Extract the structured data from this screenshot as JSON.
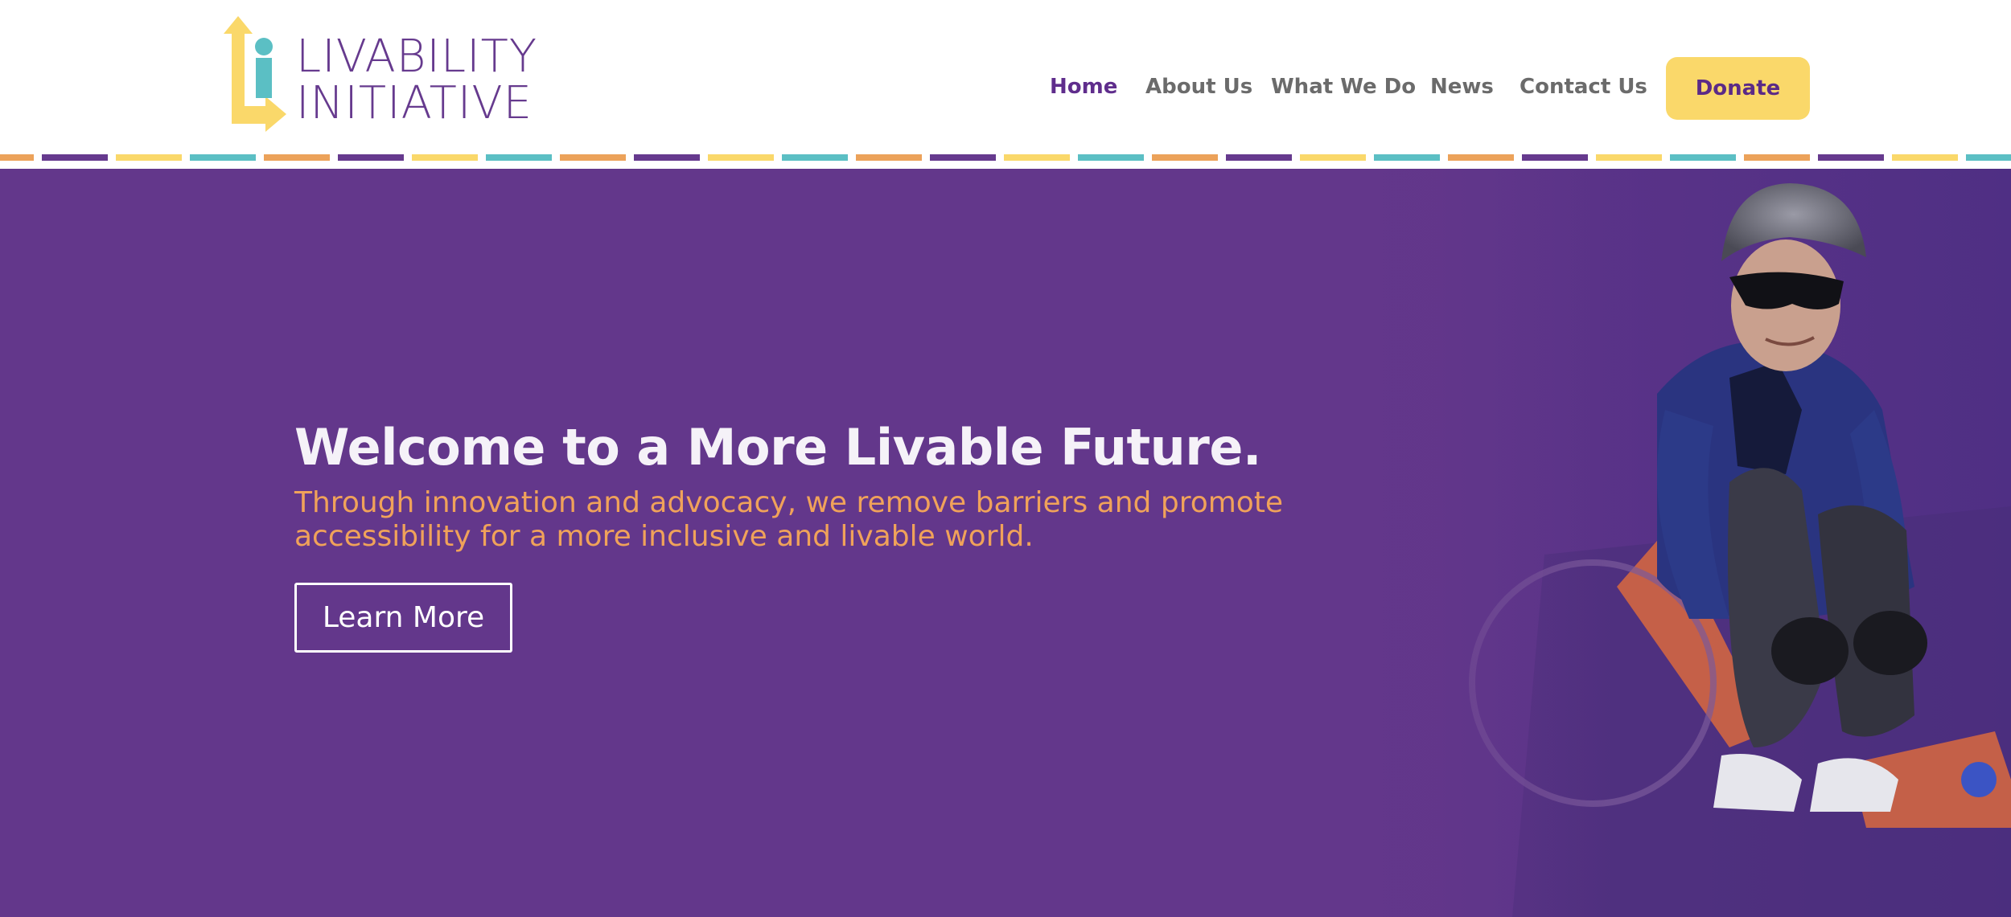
{
  "brand": {
    "line1": "LIVABILITY",
    "line2": "INITIATIVE",
    "colors": {
      "purple": "#663a8e",
      "yellow": "#fad86a",
      "teal": "#5bbfc4",
      "orange": "#eca25a"
    }
  },
  "nav": {
    "items": [
      {
        "label": "Home",
        "active": true
      },
      {
        "label": "About Us",
        "active": false
      },
      {
        "label": "What We Do",
        "active": false
      },
      {
        "label": "News",
        "active": false
      },
      {
        "label": "Contact Us",
        "active": false
      }
    ],
    "donate_label": "Donate"
  },
  "hero": {
    "title": "Welcome to a More Livable Future.",
    "subtitle": "Through innovation and advocacy, we remove barriers and promote accessibility for a more inclusive and livable world.",
    "cta_label": "Learn More",
    "background": "#63378b",
    "photo_icon": "person-in-handcycle-photo"
  }
}
